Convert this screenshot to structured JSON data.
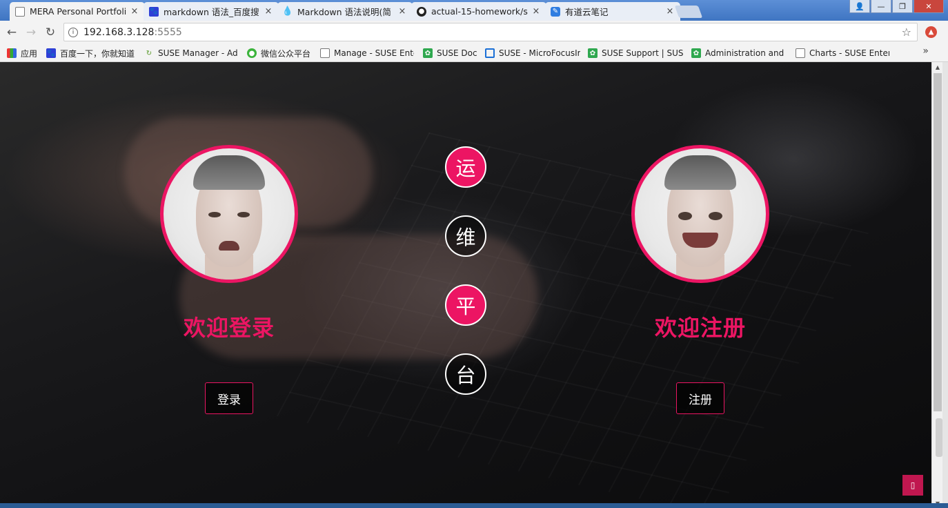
{
  "browser": {
    "tabs": [
      {
        "title": "MERA Personal Portfoli",
        "icon": "page-icon",
        "active": true
      },
      {
        "title": "markdown 语法_百度搜",
        "icon": "baidu-paw-icon",
        "active": false
      },
      {
        "title": "Markdown 语法说明(简",
        "icon": "markdown-drop-icon",
        "active": false
      },
      {
        "title": "actual-15-homework/s",
        "icon": "github-icon",
        "active": false
      },
      {
        "title": "有道云笔记",
        "icon": "youdao-note-icon",
        "active": false
      }
    ],
    "close_glyph": "×",
    "address": {
      "host": "192.168.3.128",
      "port": ":5555"
    },
    "bookmarks": [
      {
        "label": "应用",
        "icon": "apps-grid-icon"
      },
      {
        "label": "百度一下，你就知道",
        "icon": "baidu-paw-icon"
      },
      {
        "label": "SUSE Manager - Adr",
        "icon": "suse-manager-icon"
      },
      {
        "label": "微信公众平台",
        "icon": "wechat-icon"
      },
      {
        "label": "Manage - SUSE Ente",
        "icon": "page-icon"
      },
      {
        "label": "SUSE Doc",
        "icon": "suse-chameleon-icon"
      },
      {
        "label": "SUSE - MicroFocusIr",
        "icon": "microfocus-icon"
      },
      {
        "label": "SUSE Support | SUSE",
        "icon": "suse-chameleon-icon"
      },
      {
        "label": "Administration and",
        "icon": "suse-chameleon-icon"
      },
      {
        "label": "Charts - SUSE Enterp",
        "icon": "page-icon"
      }
    ],
    "more_glyph": "»"
  },
  "page": {
    "login": {
      "welcome": "欢迎登录",
      "button": "登录"
    },
    "register": {
      "welcome": "欢迎注册",
      "button": "注册"
    },
    "circles": [
      "运",
      "维",
      "平",
      "台"
    ],
    "accent_color": "#ec1563"
  }
}
